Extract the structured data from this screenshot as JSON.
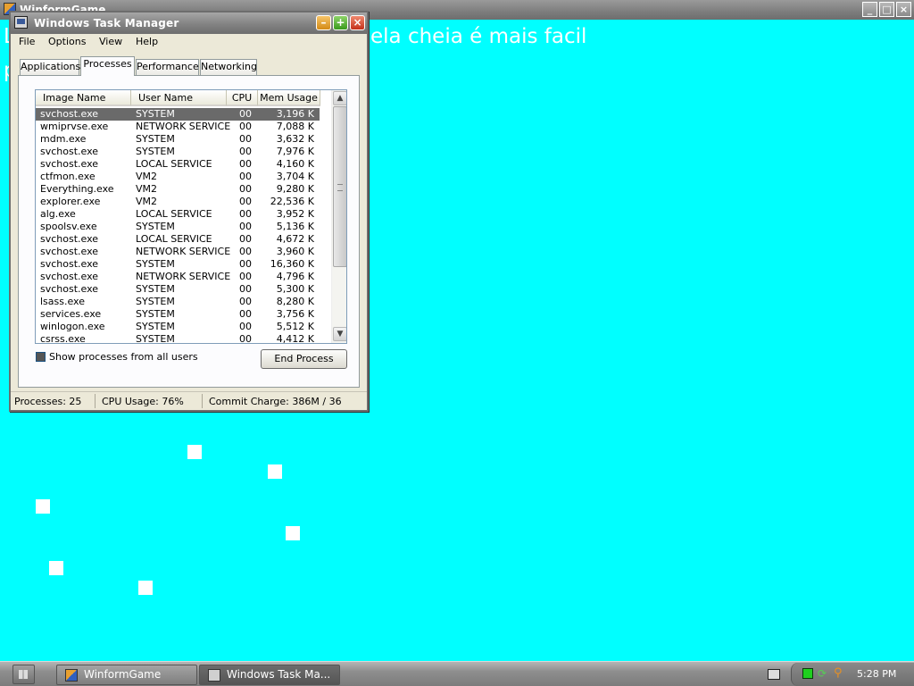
{
  "game": {
    "title": "WinformGame",
    "message": "ela cheia é mais facil",
    "message_left": "L",
    "message_left2": "p",
    "bg_color": "#00ffff"
  },
  "window": {
    "title": "Windows Task Manager",
    "controls": [
      "minimize-icon",
      "maximize-icon",
      "close-icon"
    ]
  },
  "menu": {
    "items": [
      "File",
      "Options",
      "View",
      "Help"
    ]
  },
  "tabs": [
    {
      "label": "Applications",
      "active": false
    },
    {
      "label": "Processes",
      "active": true
    },
    {
      "label": "Performance",
      "active": false
    },
    {
      "label": "Networking",
      "active": false
    }
  ],
  "processes": {
    "columns": [
      "Image Name",
      "User Name",
      "CPU",
      "Mem Usage"
    ],
    "rows": [
      {
        "image": "svchost.exe",
        "user": "SYSTEM",
        "cpu": "00",
        "mem": "3,196 K",
        "selected": true
      },
      {
        "image": "wmiprvse.exe",
        "user": "NETWORK SERVICE",
        "cpu": "00",
        "mem": "7,088 K"
      },
      {
        "image": "mdm.exe",
        "user": "SYSTEM",
        "cpu": "00",
        "mem": "3,632 K"
      },
      {
        "image": "svchost.exe",
        "user": "SYSTEM",
        "cpu": "00",
        "mem": "7,976 K"
      },
      {
        "image": "svchost.exe",
        "user": "LOCAL SERVICE",
        "cpu": "00",
        "mem": "4,160 K"
      },
      {
        "image": "ctfmon.exe",
        "user": "VM2",
        "cpu": "00",
        "mem": "3,704 K"
      },
      {
        "image": "Everything.exe",
        "user": "VM2",
        "cpu": "00",
        "mem": "9,280 K"
      },
      {
        "image": "explorer.exe",
        "user": "VM2",
        "cpu": "00",
        "mem": "22,536 K"
      },
      {
        "image": "alg.exe",
        "user": "LOCAL SERVICE",
        "cpu": "00",
        "mem": "3,952 K"
      },
      {
        "image": "spoolsv.exe",
        "user": "SYSTEM",
        "cpu": "00",
        "mem": "5,136 K"
      },
      {
        "image": "svchost.exe",
        "user": "LOCAL SERVICE",
        "cpu": "00",
        "mem": "4,672 K"
      },
      {
        "image": "svchost.exe",
        "user": "NETWORK SERVICE",
        "cpu": "00",
        "mem": "3,960 K"
      },
      {
        "image": "svchost.exe",
        "user": "SYSTEM",
        "cpu": "00",
        "mem": "16,360 K"
      },
      {
        "image": "svchost.exe",
        "user": "NETWORK SERVICE",
        "cpu": "00",
        "mem": "4,796 K"
      },
      {
        "image": "svchost.exe",
        "user": "SYSTEM",
        "cpu": "00",
        "mem": "5,300 K"
      },
      {
        "image": "lsass.exe",
        "user": "SYSTEM",
        "cpu": "00",
        "mem": "8,280 K"
      },
      {
        "image": "services.exe",
        "user": "SYSTEM",
        "cpu": "00",
        "mem": "3,756 K"
      },
      {
        "image": "winlogon.exe",
        "user": "SYSTEM",
        "cpu": "00",
        "mem": "5,512 K"
      },
      {
        "image": "csrss.exe",
        "user": "SYSTEM",
        "cpu": "00",
        "mem": "4,412 K"
      }
    ]
  },
  "show_all": {
    "label": "Show processes from all users",
    "checked": true
  },
  "end_process_label": "End Process",
  "status": {
    "processes": "Processes: 25",
    "cpu": "CPU Usage: 76%",
    "commit": "Commit Charge: 386M / 36"
  },
  "taskbar": {
    "buttons": [
      {
        "label": "WinformGame",
        "active": false
      },
      {
        "label": "Windows Task Ma...",
        "active": true
      }
    ],
    "clock": "5:28 PM"
  }
}
